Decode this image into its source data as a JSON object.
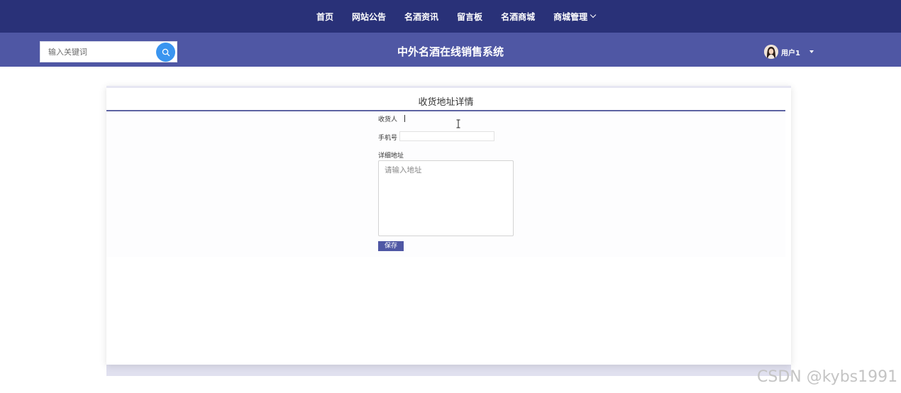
{
  "nav": {
    "items": [
      {
        "label": "首页"
      },
      {
        "label": "网站公告"
      },
      {
        "label": "名酒资讯"
      },
      {
        "label": "留言板"
      },
      {
        "label": "名酒商城"
      },
      {
        "label": "商城管理",
        "has_dropdown": true
      }
    ]
  },
  "header": {
    "search_placeholder": "输入关键词",
    "site_title": "中外名酒在线销售系统",
    "user_name": "用户1",
    "search_icon": "search-icon",
    "accent_color": "#3a95f0"
  },
  "card": {
    "title": "收货地址详情"
  },
  "form": {
    "receiver_label": "收货人",
    "receiver_value": "",
    "phone_label": "手机号",
    "phone_value": "",
    "address_label": "详细地址",
    "address_placeholder": "请输入地址",
    "address_value": "",
    "save_label": "保存"
  },
  "colors": {
    "nav_bg": "#293178",
    "header_bg": "#4f57a4",
    "save_button_bg": "#4f57a4"
  },
  "watermark": "CSDN @kybs1991"
}
